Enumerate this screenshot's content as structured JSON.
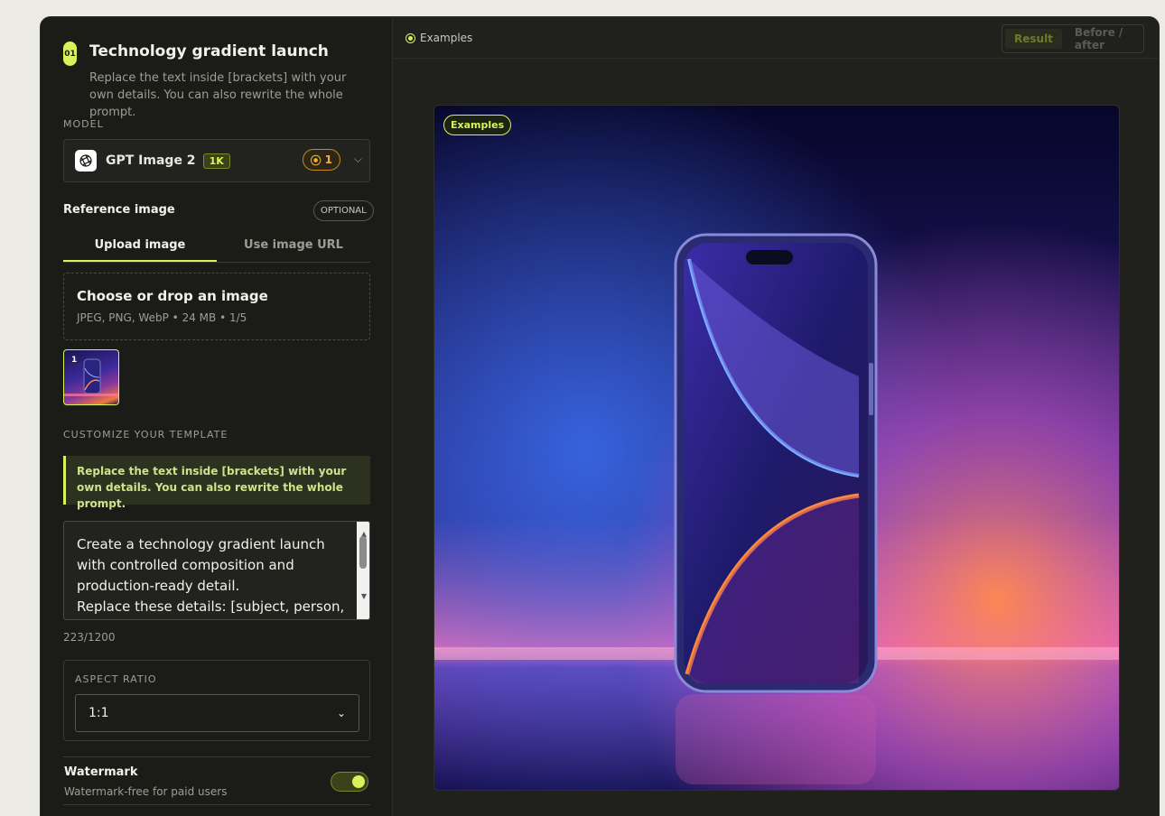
{
  "step": {
    "number": "01",
    "title": "Technology gradient launch",
    "subtitle": "Replace the text inside [brackets] with your own details. You can also rewrite the whole prompt."
  },
  "model": {
    "section_label": "MODEL",
    "name": "GPT Image 2",
    "resolution": "1K",
    "credits": "1",
    "logo_icon": "openai-logo-icon"
  },
  "reference": {
    "label": "Reference image",
    "optional_label": "OPTIONAL",
    "tabs": [
      {
        "label": "Upload image",
        "active": true
      },
      {
        "label": "Use image URL",
        "active": false
      }
    ],
    "dropzone": {
      "title": "Choose or drop an image",
      "formats": "JPEG, PNG, WebP",
      "max_size": "24 MB",
      "count": "1/5"
    },
    "thumbnail_index": "1"
  },
  "customize": {
    "section_label": "CUSTOMIZE YOUR TEMPLATE",
    "notice": "Replace the text inside [brackets] with your own details. You can also rewrite the whole prompt.",
    "prompt_text": "Create a technology gradient launch with controlled composition and production-ready detail.\nReplace these details: [subject, person, or",
    "char_count": "223/1200"
  },
  "aspect_ratio": {
    "label": "ASPECT RATIO",
    "value": "1:1"
  },
  "watermark": {
    "title": "Watermark",
    "subtitle": "Watermark-free for paid users",
    "enabled": true
  },
  "topbar": {
    "examples_label": "Examples",
    "view_modes": [
      {
        "label": "Result",
        "active": true
      },
      {
        "label": "Before / after",
        "active": false
      }
    ]
  },
  "canvas": {
    "badge": "Examples"
  },
  "colors": {
    "accent": "#d8f25a",
    "credit": "#f2b23a",
    "panel": "#1b1c18"
  }
}
